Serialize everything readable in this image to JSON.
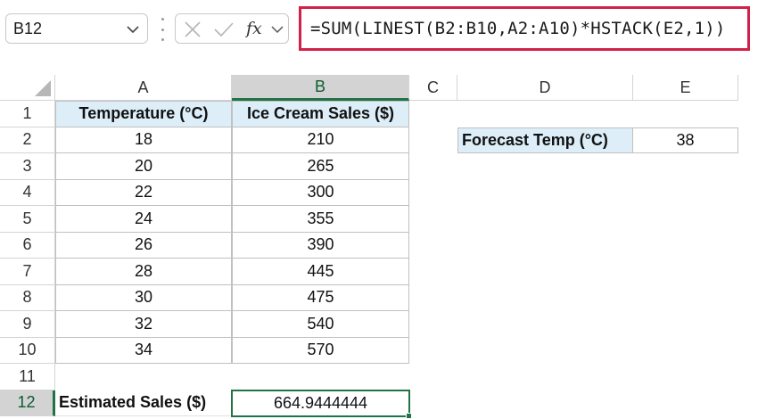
{
  "formula_bar": {
    "name_box": "B12",
    "formula": "=SUM(LINEST(B2:B10,A2:A10)*HSTACK(E2,1))"
  },
  "icons": {
    "name_box_dropdown": "chevron-down-icon",
    "cancel": "close-icon",
    "enter": "check-icon",
    "insert_function": "fx-icon",
    "expand": "chevron-down-icon"
  },
  "colors": {
    "formula_highlight": "#d32049",
    "selection": "#217346",
    "header_fill": "#ddeef8",
    "heading_selected": "#d3d3d3"
  },
  "columns": [
    "A",
    "B",
    "C",
    "D",
    "E"
  ],
  "rows": [
    "1",
    "2",
    "3",
    "4",
    "5",
    "6",
    "7",
    "8",
    "9",
    "10",
    "11",
    "12"
  ],
  "table": {
    "headers": [
      "Temperature (°C)",
      "Ice Cream Sales ($)"
    ],
    "rows": [
      [
        "18",
        "210"
      ],
      [
        "20",
        "265"
      ],
      [
        "22",
        "300"
      ],
      [
        "24",
        "355"
      ],
      [
        "26",
        "390"
      ],
      [
        "28",
        "445"
      ],
      [
        "30",
        "475"
      ],
      [
        "32",
        "540"
      ],
      [
        "34",
        "570"
      ]
    ]
  },
  "forecast": {
    "label": "Forecast Temp (°C)",
    "value": "38"
  },
  "result": {
    "label": "Estimated Sales ($)",
    "value": "664.9444444"
  },
  "selected_cell": "B12"
}
